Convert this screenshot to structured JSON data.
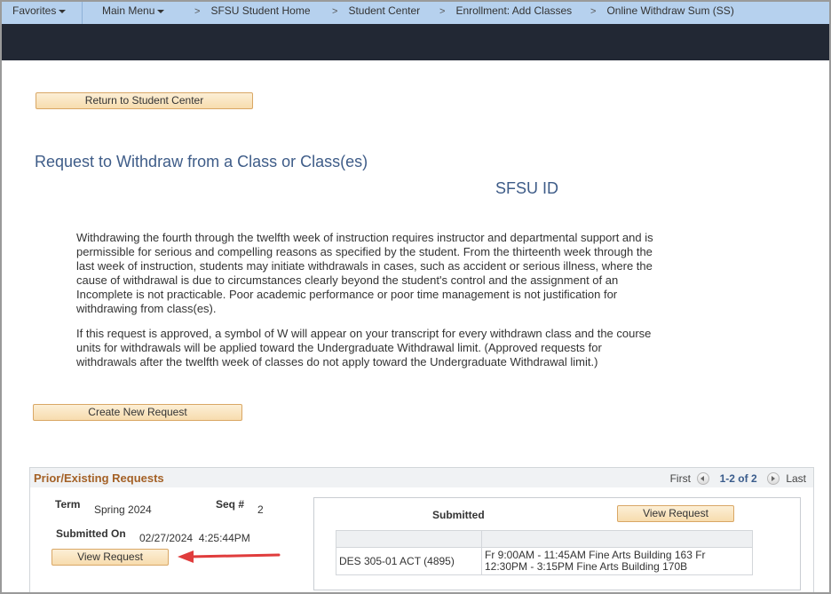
{
  "navbar": {
    "favorites": "Favorites",
    "main_menu": "Main Menu",
    "breadcrumbs": [
      "SFSU Student Home",
      "Student Center",
      "Enrollment: Add Classes",
      "Online Withdraw Sum (SS)"
    ],
    "separator": ">"
  },
  "buttons": {
    "return": "Return to Student Center",
    "create": "Create New Request",
    "view_request": "View Request"
  },
  "page": {
    "title": "Request to Withdraw from a Class or Class(es)",
    "subtitle": "SFSU ID",
    "paragraph1": "Withdrawing the fourth through the twelfth week of instruction requires instructor and departmental support and is permissible for serious and compelling reasons as specified by the student.  From the thirteenth week through the last week of instruction, students may initiate withdrawals in cases, such as accident or serious illness, where the cause of withdrawal is due to circumstances clearly beyond the student's control and the assignment of an Incomplete is not practicable.  Poor academic performance or poor time management is not justification for withdrawing from class(es).",
    "paragraph2": "If this request is approved, a symbol of W will appear on your transcript for every withdrawn class and the course units for withdrawals will be applied toward the Undergraduate Withdrawal limit.  (Approved requests for withdrawals after the twelfth week of classes do not apply toward the Undergraduate Withdrawal limit.)"
  },
  "requests": {
    "title": "Prior/Existing Requests",
    "pager": {
      "first": "First",
      "count": "1-2 of 2",
      "last": "Last"
    },
    "row": {
      "term_label": "Term",
      "term_value": "Spring 2024",
      "seq_label": "Seq #",
      "seq_value": "2",
      "submitted_on_label": "Submitted On",
      "submitted_on_value": "02/27/2024  4:25:44PM",
      "status": "Submitted",
      "classes": [
        {
          "class": "DES 305-01 ACT (4895)",
          "schedule": "Fr 9:00AM - 11:45AM Fine Arts Building 163 Fr 12:30PM - 3:15PM Fine Arts Building 170B"
        }
      ]
    }
  },
  "colors": {
    "navbar": "#b6d1ee",
    "darkbar": "#222834",
    "title": "#3e5c88",
    "grid_title": "#a46126",
    "arrow": "#e03c3c"
  }
}
